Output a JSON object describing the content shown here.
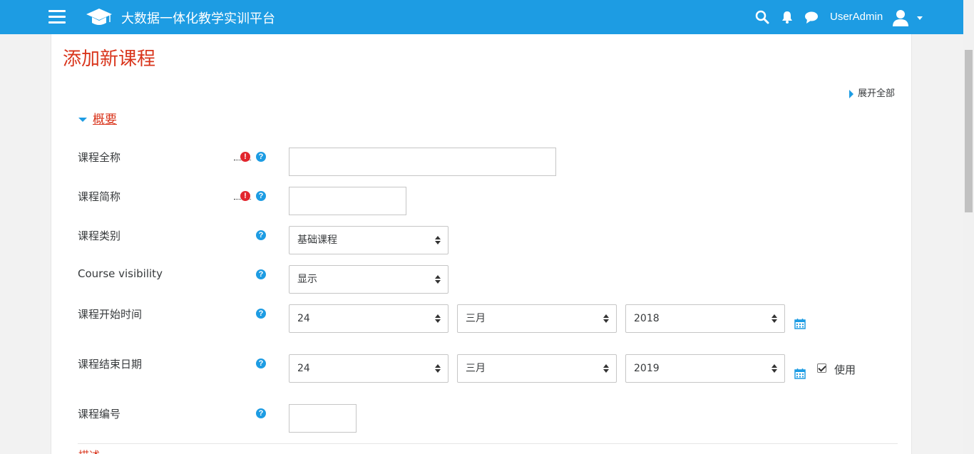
{
  "header": {
    "site_title": "大数据一体化教学实训平台",
    "username": "UserAdmin",
    "icons": [
      "menu-icon",
      "graduation-cap-icon",
      "search-icon",
      "bell-icon",
      "chat-icon",
      "user-avatar-icon",
      "caret-down-icon"
    ]
  },
  "page": {
    "title": "添加新课程",
    "expand_all": "展开全部"
  },
  "section": {
    "general_title": "概要",
    "next_title_partial": "描述"
  },
  "form": {
    "fullname": {
      "label": "课程全称",
      "value": "",
      "required": true
    },
    "shortname": {
      "label": "课程简称",
      "value": "",
      "required": true
    },
    "category": {
      "label": "课程类别",
      "selected": "基础课程"
    },
    "visibility": {
      "label": "Course visibility",
      "selected": "显示"
    },
    "startdate": {
      "label": "课程开始时间",
      "day": "24",
      "month": "三月",
      "year": "2018"
    },
    "enddate": {
      "label": "课程结束日期",
      "day": "24",
      "month": "三月",
      "year": "2019",
      "enable_label": "使用",
      "enabled": true
    },
    "idnumber": {
      "label": "课程编号",
      "value": ""
    }
  },
  "icon_glyphs": {
    "help": "?",
    "required": "!"
  },
  "colors": {
    "navbar": "#1d9ce3",
    "title_red": "#d9351c",
    "required_red": "#e2252d",
    "help_blue": "#1d9ce3"
  }
}
